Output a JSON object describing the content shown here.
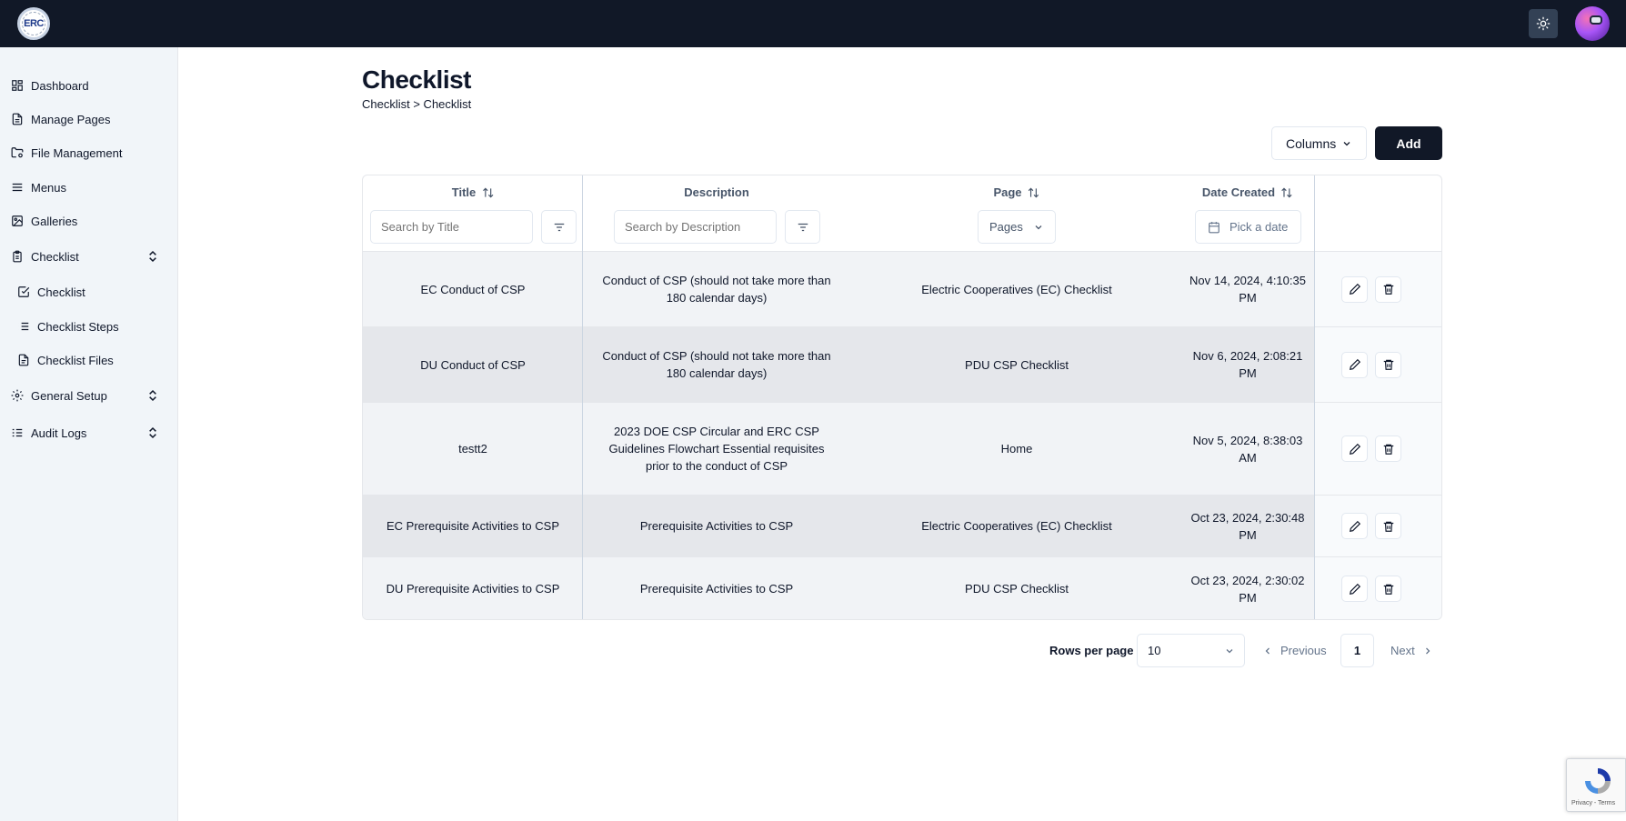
{
  "header": {
    "logo_text": "ERC",
    "theme_toggle_icon": "sun-icon"
  },
  "sidebar": {
    "items": [
      {
        "label": "Dashboard",
        "icon": "dashboard-icon"
      },
      {
        "label": "Manage Pages",
        "icon": "file-text-icon"
      },
      {
        "label": "File Management",
        "icon": "folder-cog-icon"
      },
      {
        "label": "Menus",
        "icon": "menu-icon"
      },
      {
        "label": "Galleries",
        "icon": "image-icon"
      },
      {
        "label": "Checklist",
        "icon": "clipboard-icon"
      },
      {
        "label": "Checklist",
        "icon": "check-square-icon"
      },
      {
        "label": "Checklist Steps",
        "icon": "list-icon"
      },
      {
        "label": "Checklist Files",
        "icon": "file-icon"
      },
      {
        "label": "General Setup",
        "icon": "gear-icon"
      },
      {
        "label": "Audit Logs",
        "icon": "list-checks-icon"
      }
    ]
  },
  "main": {
    "title": "Checklist",
    "breadcrumb": "Checklist > Checklist",
    "columns_button": "Columns",
    "add_button": "Add"
  },
  "table": {
    "headers": {
      "title": "Title",
      "description": "Description",
      "page": "Page",
      "date": "Date Created"
    },
    "filters": {
      "title_placeholder": "Search by Title",
      "description_placeholder": "Search by Description",
      "pages_select": "Pages",
      "date_placeholder": "Pick a date"
    },
    "rows": [
      {
        "title": "EC Conduct of CSP",
        "description": "Conduct of CSP (should not take more than 180 calendar days)",
        "page": "Electric Cooperatives (EC) Checklist",
        "date": "Nov 14, 2024, 4:10:35 PM"
      },
      {
        "title": "DU Conduct of CSP",
        "description": "Conduct of CSP (should not take more than 180 calendar days)",
        "page": "PDU CSP Checklist",
        "date": "Nov 6, 2024, 2:08:21 PM"
      },
      {
        "title": "testt2",
        "description": "2023 DOE CSP Circular and ERC CSP Guidelines Flowchart Essential requisites prior to the conduct of CSP",
        "page": "Home",
        "date": "Nov 5, 2024, 8:38:03 AM"
      },
      {
        "title": "EC Prerequisite Activities to CSP",
        "description": "Prerequisite Activities to CSP",
        "page": "Electric Cooperatives (EC) Checklist",
        "date": "Oct 23, 2024, 2:30:48 PM"
      },
      {
        "title": "DU Prerequisite Activities to CSP",
        "description": "Prerequisite Activities to CSP",
        "page": "PDU CSP Checklist",
        "date": "Oct 23, 2024, 2:30:02 PM"
      }
    ]
  },
  "pagination": {
    "rows_per_page_label": "Rows per page",
    "rows_per_page_value": "10",
    "previous": "Previous",
    "current_page": "1",
    "next": "Next"
  },
  "recaptcha": {
    "terms": "Privacy - Terms"
  }
}
